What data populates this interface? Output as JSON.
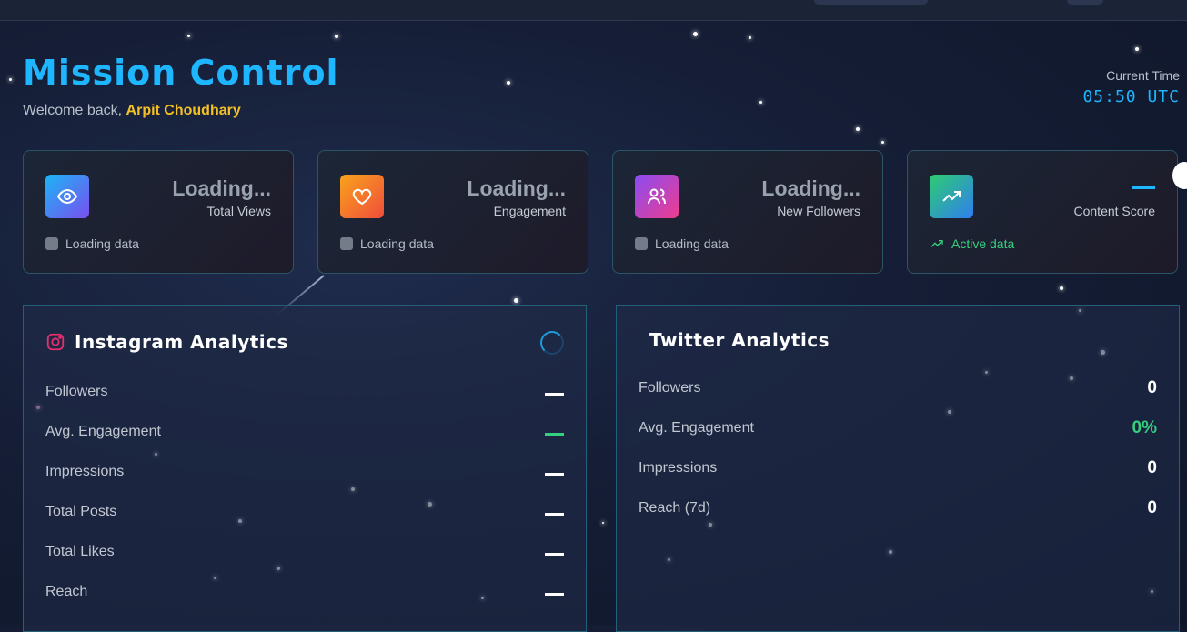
{
  "header": {
    "title": "Mission Control",
    "welcome_prefix": "Welcome back, ",
    "user_name": "Arpit Choudhary",
    "time_label": "Current Time",
    "time_value": "05:50 UTC"
  },
  "cards": [
    {
      "value": "Loading...",
      "label": "Total Views",
      "footer": "Loading data",
      "icon": "eye-icon"
    },
    {
      "value": "Loading...",
      "label": "Engagement",
      "footer": "Loading data",
      "icon": "heart-icon"
    },
    {
      "value": "Loading...",
      "label": "New Followers",
      "footer": "Loading data",
      "icon": "users-icon"
    },
    {
      "value": "",
      "label": "Content Score",
      "footer": "Active data",
      "icon": "trending-up-icon"
    }
  ],
  "instagram": {
    "title": "Instagram Analytics",
    "rows": [
      {
        "label": "Followers"
      },
      {
        "label": "Avg. Engagement"
      },
      {
        "label": "Impressions"
      },
      {
        "label": "Total Posts"
      },
      {
        "label": "Total Likes"
      },
      {
        "label": "Reach"
      }
    ]
  },
  "twitter": {
    "title": "Twitter Analytics",
    "rows": [
      {
        "label": "Followers",
        "value": "0"
      },
      {
        "label": "Avg. Engagement",
        "value": "0%"
      },
      {
        "label": "Impressions",
        "value": "0"
      },
      {
        "label": "Reach (7d)",
        "value": "0"
      }
    ]
  },
  "colors": {
    "accent": "#1eb6ff",
    "user": "#f5c025",
    "positive": "#35d07f",
    "instagram": "#e1306c"
  }
}
